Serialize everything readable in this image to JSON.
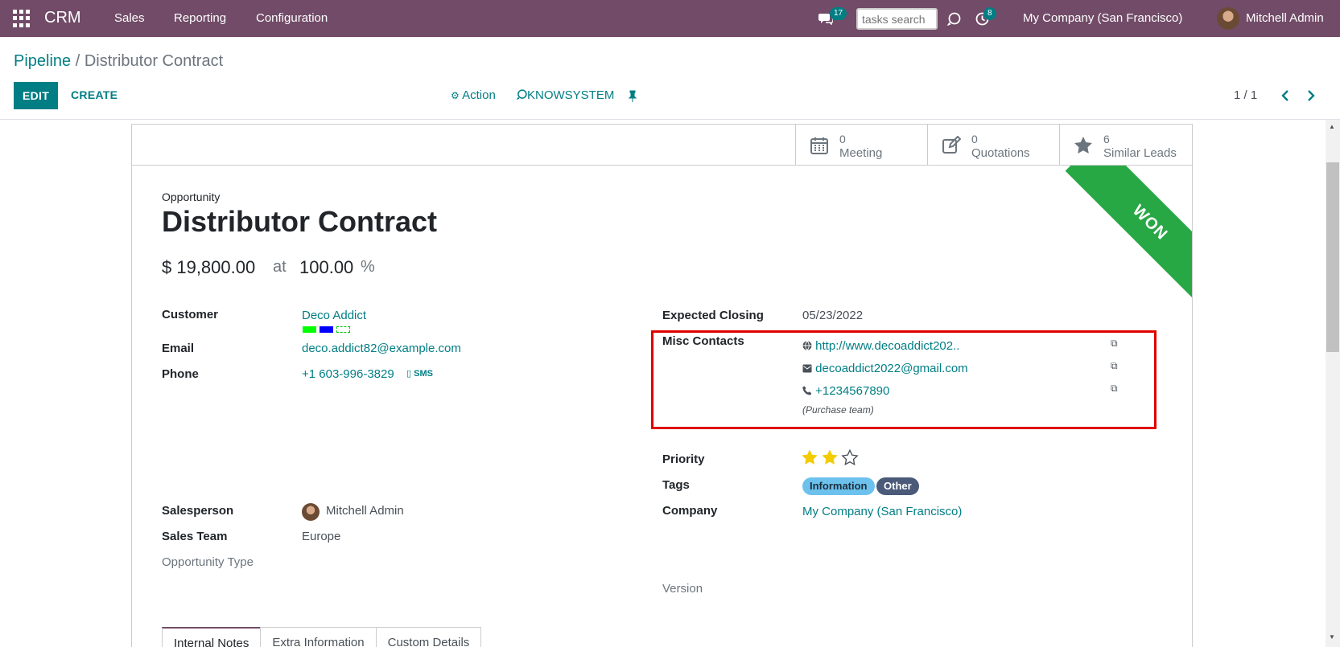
{
  "topnav": {
    "app_name": "CRM",
    "menus": [
      "Sales",
      "Reporting",
      "Configuration"
    ],
    "messages_count": "17",
    "task_search_placeholder": "tasks search",
    "activities_count": "8",
    "company": "My Company (San Francisco)",
    "user": "Mitchell Admin",
    "nav_bg": "#714B67"
  },
  "control_panel": {
    "breadcrumb_parent": "Pipeline",
    "breadcrumb_separator": " / ",
    "breadcrumb_current": "Distributor Contract",
    "edit_label": "EDIT",
    "create_label": "CREATE",
    "action_label": "Action",
    "knowsystem_label": "KNOWSYSTEM",
    "pager": "1 / 1"
  },
  "stat_buttons": [
    {
      "value": "0",
      "label": "Meeting",
      "icon": "calendar-icon"
    },
    {
      "value": "0",
      "label": "Quotations",
      "icon": "edit-icon"
    },
    {
      "value": "6",
      "label": "Similar Leads",
      "icon": "star-icon"
    }
  ],
  "ribbon": {
    "text": "WON",
    "color": "#28a745"
  },
  "record": {
    "type_label": "Opportunity",
    "name": "Distributor Contract",
    "revenue": "$ 19,800.00",
    "at_label": "at",
    "probability": "100.00",
    "percent_sign": "%"
  },
  "left_fields": {
    "customer_label": "Customer",
    "customer_value": "Deco Addict",
    "customer_tag_colors": [
      "#00ff00",
      "#0000ff",
      "#00ff00"
    ],
    "email_label": "Email",
    "email_value": "deco.addict82@example.com",
    "phone_label": "Phone",
    "phone_value": "+1 603-996-3829",
    "sms_label": "SMS",
    "salesperson_label": "Salesperson",
    "salesperson_value": "Mitchell Admin",
    "sales_team_label": "Sales Team",
    "sales_team_value": "Europe",
    "opportunity_type_label": "Opportunity Type"
  },
  "right_fields": {
    "expected_closing_label": "Expected Closing",
    "expected_closing_value": "05/23/2022",
    "misc_contacts_label": "Misc Contacts",
    "misc_contacts": [
      {
        "icon": "globe-icon",
        "value": "http://www.decoaddict202.."
      },
      {
        "icon": "envelope-icon",
        "value": "decoaddict2022@gmail.com"
      },
      {
        "icon": "phone-icon",
        "value": "+1234567890"
      }
    ],
    "misc_contacts_note": "(Purchase team)",
    "priority_label": "Priority",
    "priority_stars": 2,
    "priority_max": 3,
    "tags_label": "Tags",
    "tags": [
      {
        "label": "Information",
        "bg": "#6cc1ed",
        "color": "#1c2d3a"
      },
      {
        "label": "Other",
        "bg": "#4a5a78",
        "color": "#ffffff"
      }
    ],
    "company_label": "Company",
    "company_value": "My Company (San Francisco)",
    "version_label": "Version"
  },
  "notebook_tabs": [
    "Internal Notes",
    "Extra Information",
    "Custom Details"
  ]
}
